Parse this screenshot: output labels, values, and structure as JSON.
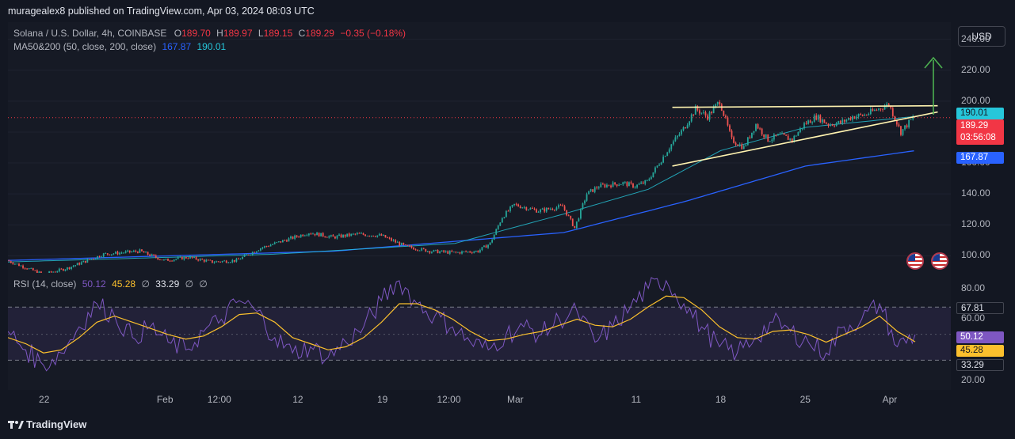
{
  "header": {
    "published_text": "muragealex8 published on TradingView.com, Apr 03, 2024 08:03 UTC"
  },
  "legend": {
    "symbol": "Solana / U.S. Dollar, 4h, COINBASE",
    "o_label": "O",
    "o_value": "189.70",
    "h_label": "H",
    "h_value": "189.97",
    "l_label": "L",
    "l_value": "189.15",
    "c_label": "C",
    "c_value": "189.29",
    "change": "−0.35 (−0.18%)",
    "ma_label": "MA50&200 (50, close, 200, close)",
    "ma50": "167.87",
    "ma200": "190.01"
  },
  "rsi_legend": {
    "label": "RSI (14, close)",
    "rsi": "50.12",
    "ma": "45.28",
    "empty1": "∅",
    "upper": "33.29",
    "empty2": "∅",
    "empty3": "∅"
  },
  "currency_button": "USD",
  "tags": {
    "ma200": "190.01",
    "last_price": "189.29",
    "countdown": "03:56:08",
    "ma50": "167.87",
    "rsi_upper": "67.81",
    "rsi_value": "50.12",
    "rsi_ma": "45.28",
    "rsi_lower": "33.29"
  },
  "footer": {
    "logo_text": "TradingView"
  },
  "icons": [
    "us-flag-icon",
    "us-flag-icon",
    "green-up-arrow-icon",
    "tradingview-logo-icon"
  ],
  "colors": {
    "up": "#26a69a",
    "down": "#ef5350",
    "ma50": "#26c6da",
    "ma200": "#2962ff",
    "rsi": "#7e57c2",
    "rsi_ma": "#fbc02d",
    "trendline": "#fff3b0",
    "arrow": "#4caf50"
  },
  "chart_data": [
    {
      "type": "candlestick",
      "title": "Solana / U.S. Dollar, 4h, COINBASE",
      "y_ticks": [
        "240.00",
        "220.00",
        "200.00",
        "180.00",
        "160.00",
        "140.00",
        "120.00",
        "100.00"
      ],
      "x_ticks": [
        "22",
        "Feb",
        "12:00",
        "12",
        "19",
        "12:00",
        "Mar",
        "11",
        "18",
        "25",
        "Apr"
      ],
      "ylim": [
        92,
        248
      ],
      "close_anchors": [
        [
          "Jan 19",
          97
        ],
        [
          "Jan 22",
          88
        ],
        [
          "Jan 24",
          92
        ],
        [
          "Jan 27",
          101
        ],
        [
          "Jan 30",
          103
        ],
        [
          "Feb 01",
          97
        ],
        [
          "Feb 03",
          99
        ],
        [
          "Feb 05",
          96
        ],
        [
          "Feb 07",
          97
        ],
        [
          "Feb 09",
          105
        ],
        [
          "Feb 11",
          110
        ],
        [
          "Feb 13",
          115
        ],
        [
          "Feb 15",
          112
        ],
        [
          "Feb 17",
          114
        ],
        [
          "Feb 19",
          113
        ],
        [
          "Feb 21",
          106
        ],
        [
          "Feb 23",
          103
        ],
        [
          "Feb 25",
          102
        ],
        [
          "Feb 27",
          103
        ],
        [
          "Feb 28",
          108
        ],
        [
          "Feb 29",
          125
        ],
        [
          "Mar 01",
          133
        ],
        [
          "Mar 03",
          129
        ],
        [
          "Mar 05",
          132
        ],
        [
          "Mar 06",
          118
        ],
        [
          "Mar 07",
          140
        ],
        [
          "Mar 08",
          145
        ],
        [
          "Mar 10",
          147
        ],
        [
          "Mar 11",
          145
        ],
        [
          "Mar 12",
          148
        ],
        [
          "Mar 13",
          160
        ],
        [
          "Mar 14",
          172
        ],
        [
          "Mar 15",
          182
        ],
        [
          "Mar 16",
          195
        ],
        [
          "Mar 17",
          190
        ],
        [
          "Mar 18",
          200
        ],
        [
          "Mar 19",
          175
        ],
        [
          "Mar 20",
          170
        ],
        [
          "Mar 21",
          185
        ],
        [
          "Mar 22",
          175
        ],
        [
          "Mar 23",
          178
        ],
        [
          "Mar 24",
          175
        ],
        [
          "Mar 25",
          185
        ],
        [
          "Mar 26",
          190
        ],
        [
          "Mar 27",
          185
        ],
        [
          "Mar 28",
          186
        ],
        [
          "Mar 29",
          190
        ],
        [
          "Mar 30",
          191
        ],
        [
          "Apr 01",
          198
        ],
        [
          "Apr 02",
          180
        ],
        [
          "Apr 03",
          189.29
        ]
      ],
      "ma50_anchors": [
        [
          "Jan 19",
          96
        ],
        [
          "Feb 10",
          101
        ],
        [
          "Feb 25",
          108
        ],
        [
          "Mar 05",
          127
        ],
        [
          "Mar 12",
          143
        ],
        [
          "Mar 18",
          168
        ],
        [
          "Mar 25",
          183
        ],
        [
          "Apr 03",
          190.01
        ]
      ],
      "ma200_anchors": [
        [
          "Jan 19",
          97
        ],
        [
          "Feb 15",
          103
        ],
        [
          "Mar 05",
          115
        ],
        [
          "Mar 15",
          135
        ],
        [
          "Mar 25",
          158
        ],
        [
          "Apr 03",
          167.87
        ]
      ],
      "trendlines": [
        {
          "from": [
            "Mar 14",
            196
          ],
          "to": [
            "Apr 03",
            197
          ]
        },
        {
          "from": [
            "Mar 14",
            158
          ],
          "to": [
            "Apr 03",
            193
          ]
        }
      ],
      "annotation": "green upward arrow"
    },
    {
      "type": "line",
      "title": "RSI (14, close)",
      "y_ticks": [
        "80.00",
        "60.00",
        "40.00",
        "20.00"
      ],
      "ylim": [
        17,
        87
      ],
      "bands": {
        "upper": 67.81,
        "middle": 50.12,
        "lower": 33.29
      },
      "series": [
        {
          "name": "RSI",
          "values": [
            52,
            40,
            30,
            38,
            55,
            70,
            62,
            48,
            55,
            45,
            40,
            52,
            60,
            72,
            65,
            48,
            38,
            42,
            35,
            45,
            55,
            72,
            85,
            70,
            62,
            55,
            45,
            40,
            50,
            55,
            50,
            60,
            65,
            45,
            55,
            68,
            80,
            85,
            70,
            55,
            42,
            38,
            48,
            58,
            52,
            45,
            38,
            55,
            60,
            70,
            42,
            50
          ]
        },
        {
          "name": "RSI MA",
          "values": [
            48,
            44,
            38,
            40,
            48,
            58,
            62,
            58,
            54,
            50,
            47,
            49,
            55,
            63,
            64,
            58,
            48,
            44,
            40,
            42,
            48,
            58,
            70,
            70,
            66,
            60,
            52,
            46,
            47,
            50,
            52,
            56,
            60,
            56,
            55,
            60,
            68,
            75,
            74,
            66,
            55,
            48,
            47,
            52,
            53,
            50,
            45,
            50,
            55,
            62,
            52,
            45.28
          ]
        }
      ]
    }
  ]
}
